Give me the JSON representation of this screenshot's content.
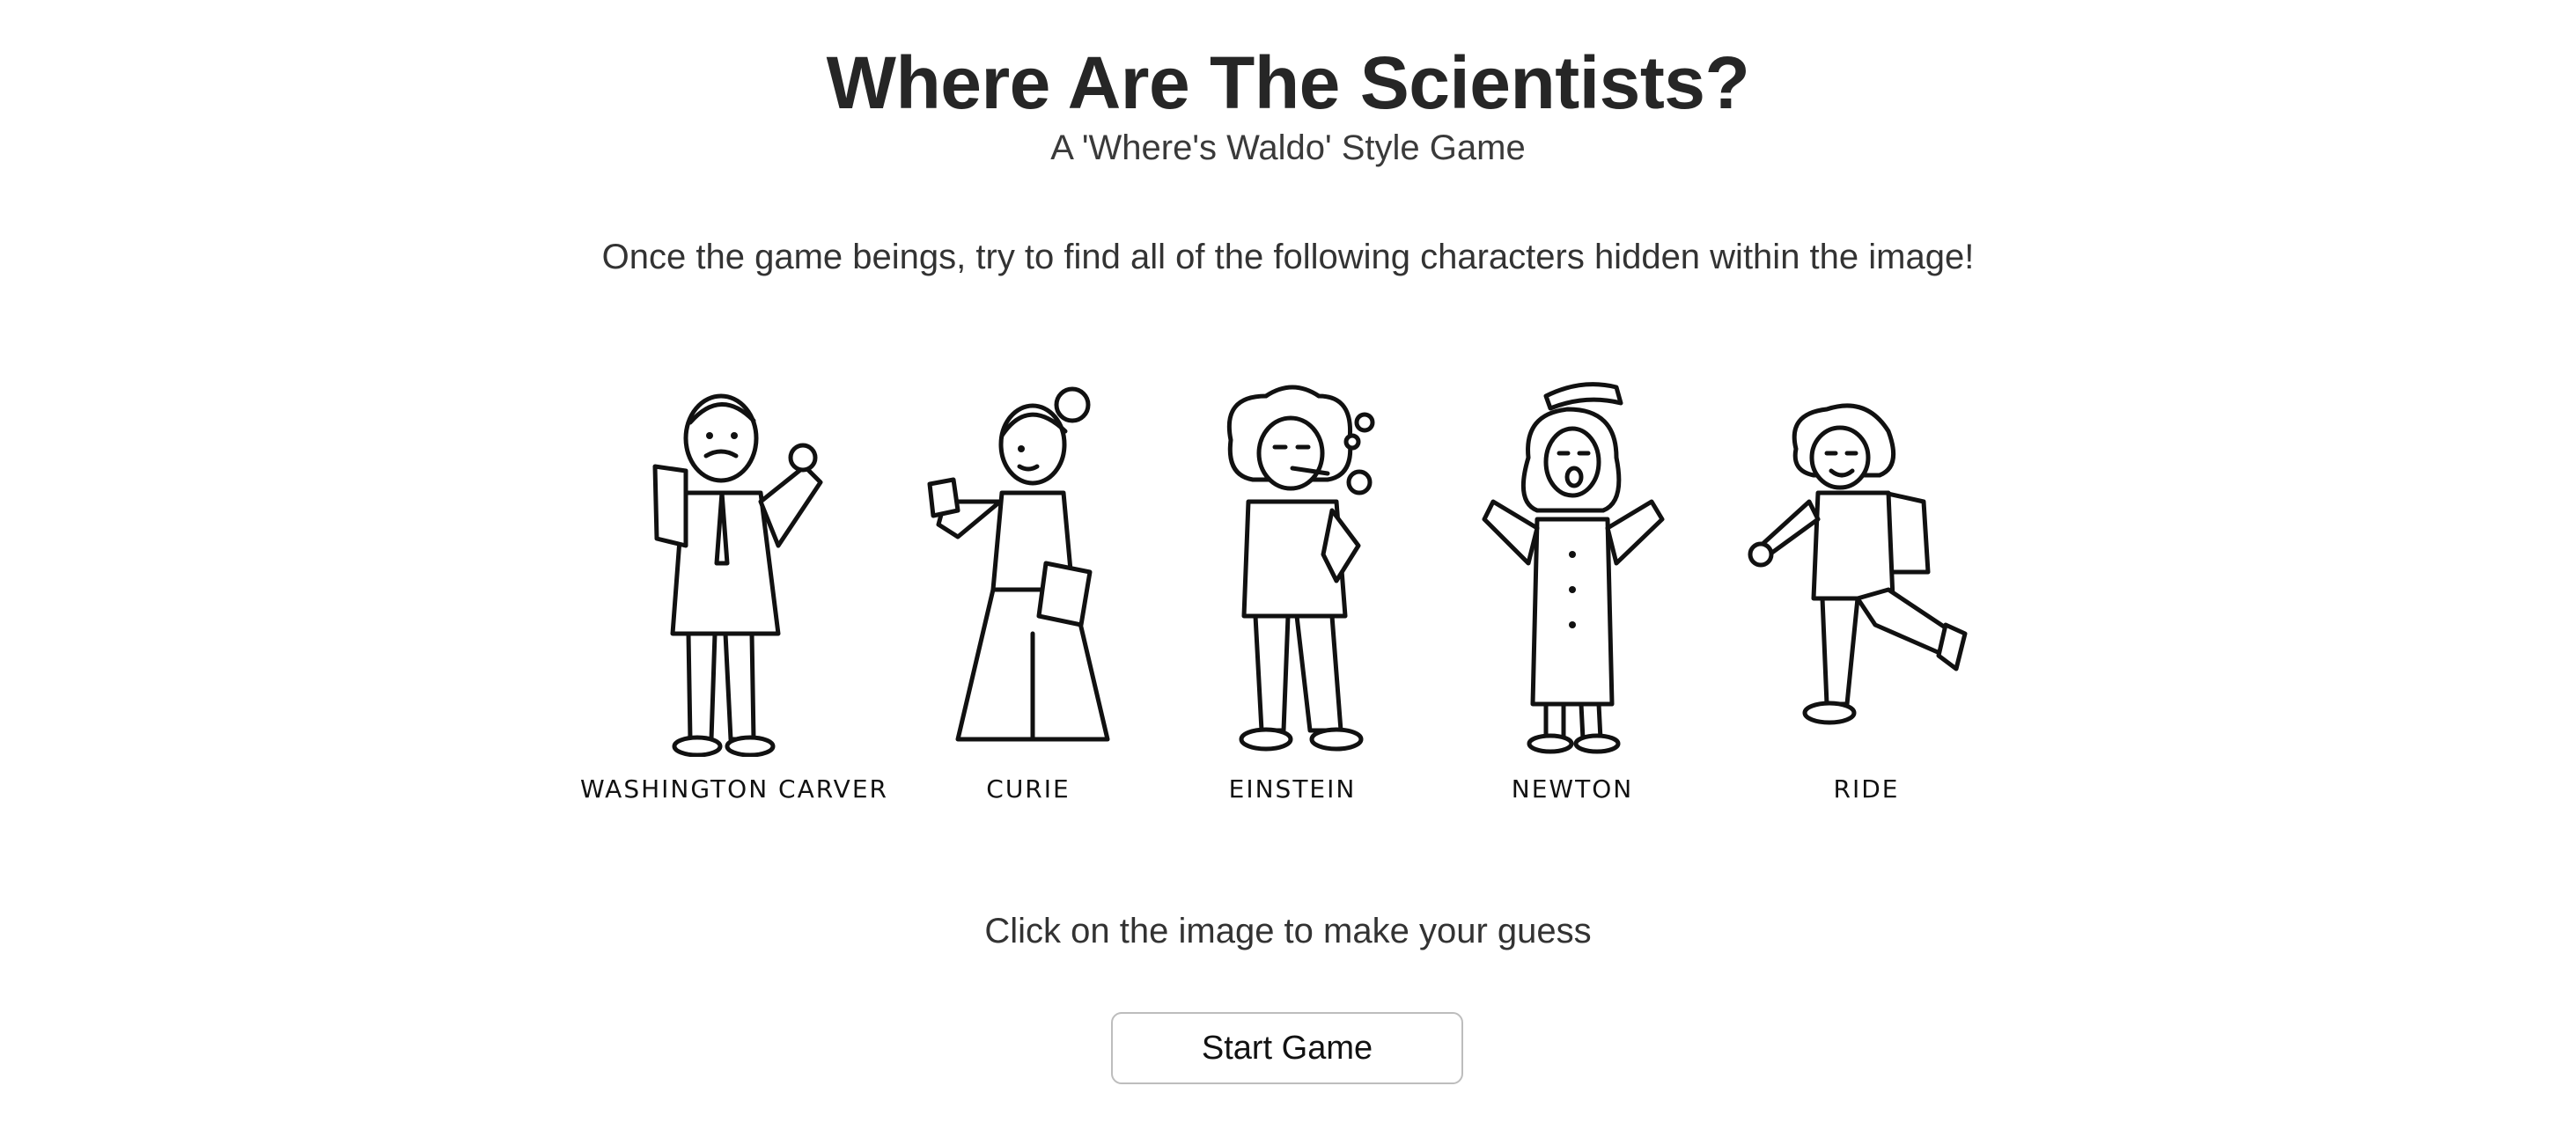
{
  "header": {
    "title": "Where Are The Scientists?",
    "subtitle": "A 'Where's Waldo' Style Game"
  },
  "instructions": "Once the game beings, try to find all of the following characters hidden within the image!",
  "characters": [
    {
      "name": "WASHINGTON CARVER"
    },
    {
      "name": "CURIE"
    },
    {
      "name": "EINSTEIN"
    },
    {
      "name": "NEWTON"
    },
    {
      "name": "RIDE"
    }
  ],
  "hint": "Click on the image to make your guess",
  "start_button": {
    "label": "Start Game"
  }
}
